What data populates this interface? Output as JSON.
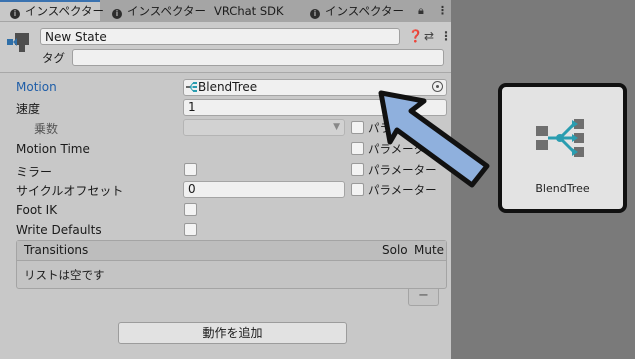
{
  "tabs": [
    {
      "label": "インスペクター",
      "icon": "info-icon",
      "active": true
    },
    {
      "label": "インスペクター",
      "icon": "info-icon",
      "active": false
    },
    {
      "label": "VRChat SDK",
      "icon": "",
      "active": false
    },
    {
      "label": "インスペクター",
      "icon": "info-icon",
      "active": false
    }
  ],
  "header": {
    "state_name": "New State",
    "tag_label": "タグ",
    "tag_value": ""
  },
  "fields": {
    "motion_label": "Motion",
    "motion_value": "BlendTree",
    "speed_label": "速度",
    "speed_value": "1",
    "multiplier_label": "乗数",
    "motion_time_label": "Motion Time",
    "mirror_label": "ミラー",
    "cycle_offset_label": "サイクルオフセット",
    "cycle_offset_value": "0",
    "foot_ik_label": "Foot IK",
    "write_defaults_label": "Write Defaults",
    "parameter_label": "パラメーター"
  },
  "transitions": {
    "header": "Transitions",
    "solo": "Solo",
    "mute": "Mute",
    "empty_text": "リストは空です",
    "remove_label": "−"
  },
  "add_behaviour_label": "動作を追加",
  "preview": {
    "label": "BlendTree",
    "icon": "blendtree-icon",
    "accent": "#2a9db0"
  },
  "colors": {
    "arrow_fill": "#8fb0dd",
    "motion_label": "#1f5ea8"
  }
}
